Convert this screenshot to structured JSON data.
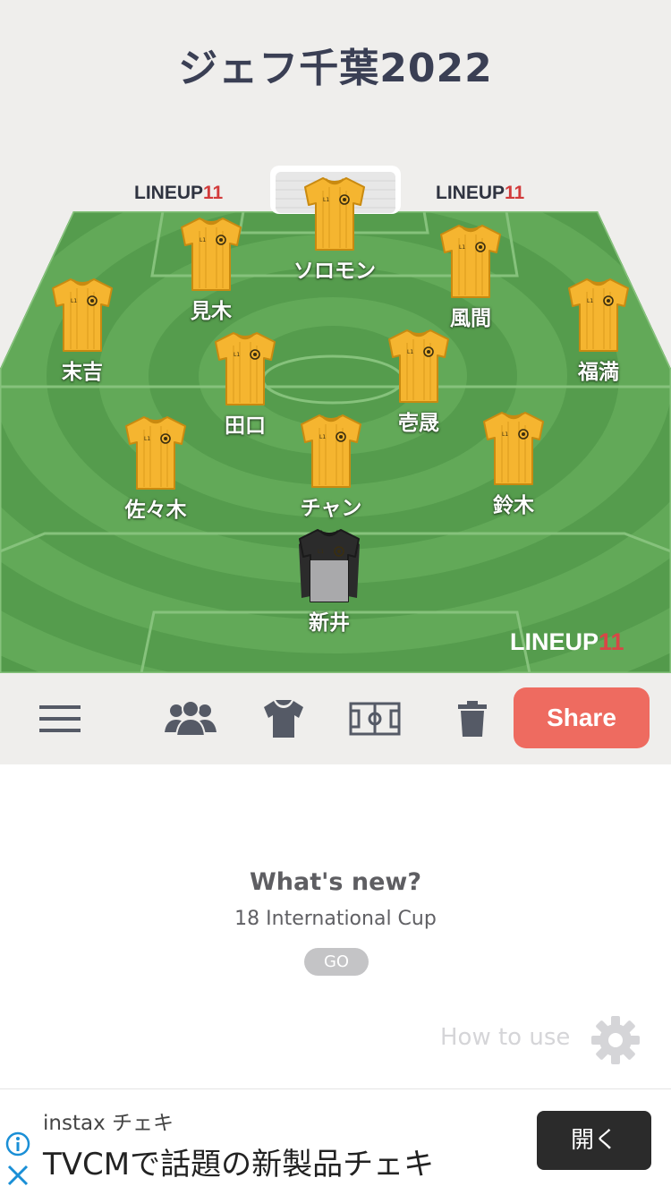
{
  "lineup": {
    "title": "ジェフ千葉2022",
    "brand": {
      "text": "LINEUP",
      "number": "11"
    },
    "players": [
      {
        "name": "ソロモン",
        "kit": "field"
      },
      {
        "name": "見木",
        "kit": "field"
      },
      {
        "name": "風間",
        "kit": "field"
      },
      {
        "name": "末吉",
        "kit": "field"
      },
      {
        "name": "福満",
        "kit": "field"
      },
      {
        "name": "田口",
        "kit": "field"
      },
      {
        "name": "壱晟",
        "kit": "field"
      },
      {
        "name": "佐々木",
        "kit": "field"
      },
      {
        "name": "チャン",
        "kit": "field"
      },
      {
        "name": "鈴木",
        "kit": "field"
      },
      {
        "name": "新井",
        "kit": "goalkeeper"
      }
    ]
  },
  "toolbar": {
    "icons": [
      "menu-icon",
      "players-icon",
      "kit-icon",
      "pitch-icon",
      "trash-icon"
    ],
    "share_label": "Share"
  },
  "news": {
    "heading": "What's new?",
    "item": "18 International Cup",
    "go_label": "GO"
  },
  "help": {
    "how_to_use": "How to use",
    "icon": "gear-icon"
  },
  "ad": {
    "brand": "instax チェキ",
    "headline": "TVCMで話題の新製品チェキ",
    "cta": "開く",
    "info_icon": "info-icon",
    "close_icon": "close-icon"
  },
  "colors": {
    "pitch_dark": "#4e9448",
    "pitch_light": "#66ad5c",
    "kit": "#f5b530",
    "goalkeeper_kit": "#2b2b2b",
    "share": "#ee6b60",
    "title": "#3a3f54"
  }
}
